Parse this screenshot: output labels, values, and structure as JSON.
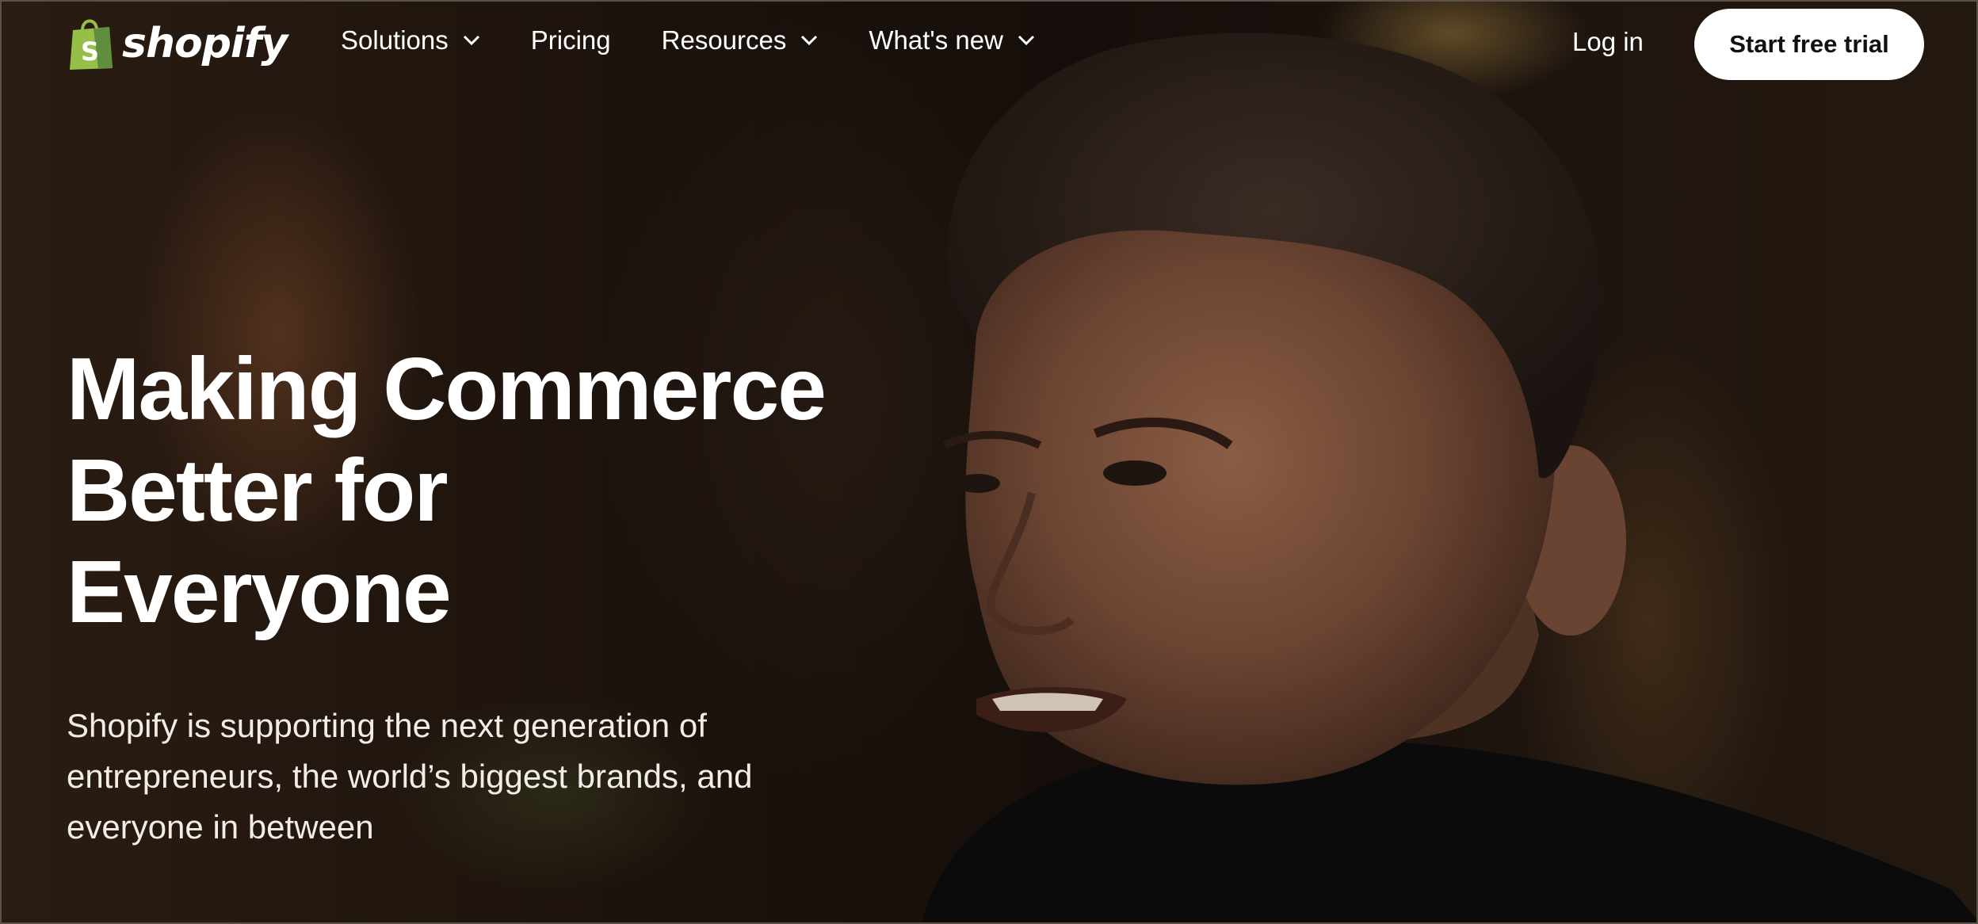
{
  "header": {
    "logo_text": "shopify",
    "logo_icon": "shopping-bag-icon",
    "nav": [
      {
        "label": "Solutions",
        "has_dropdown": true
      },
      {
        "label": "Pricing",
        "has_dropdown": false
      },
      {
        "label": "Resources",
        "has_dropdown": true
      },
      {
        "label": "What's new",
        "has_dropdown": true
      }
    ],
    "login_label": "Log in",
    "cta_label": "Start free trial"
  },
  "hero": {
    "headline_lines": [
      "Making Commerce",
      "Better for",
      "Everyone"
    ],
    "subtext": "Shopify is supporting the next generation of entrepreneurs, the world’s biggest brands, and everyone in between"
  },
  "colors": {
    "brand_green": "#95bf47",
    "cta_background": "#ffffff",
    "text": "#ffffff"
  }
}
